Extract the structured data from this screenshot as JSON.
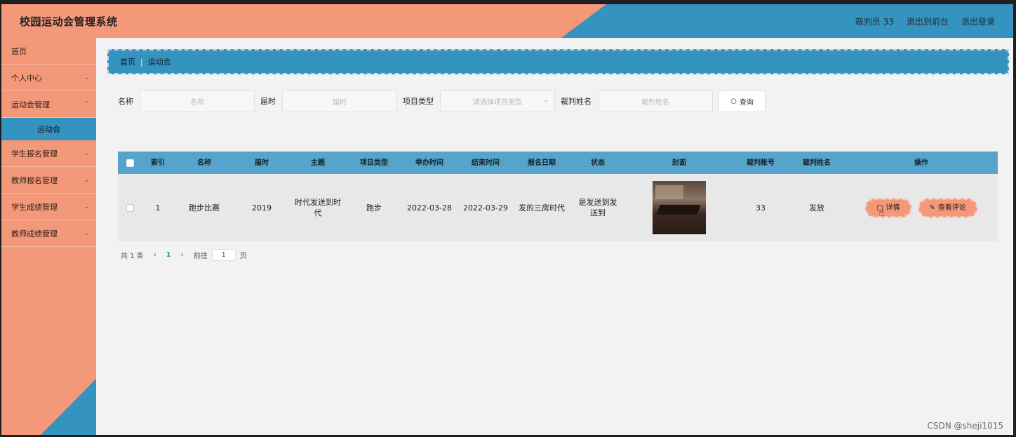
{
  "header": {
    "title": "校园运动会管理系统",
    "user": "裁判员 33",
    "front": "退出到前台",
    "logout": "退出登录"
  },
  "sidebar": {
    "items": [
      {
        "label": "首页",
        "chevron": false
      },
      {
        "label": "个人中心",
        "chevron": true
      },
      {
        "label": "运动会管理",
        "chevron": true
      },
      {
        "label": "学生报名管理",
        "chevron": true
      },
      {
        "label": "教师报名管理",
        "chevron": true
      },
      {
        "label": "学生成绩管理",
        "chevron": true
      },
      {
        "label": "教师成绩管理",
        "chevron": true
      }
    ],
    "active_sub": "运动会"
  },
  "breadcrumb": {
    "home": "首页",
    "current": "运动会"
  },
  "search": {
    "name_label": "名称",
    "name_placeholder": "名称",
    "session_label": "届时",
    "session_placeholder": "届时",
    "type_label": "项目类型",
    "type_placeholder": "请选择项目类型",
    "judge_label": "裁判姓名",
    "judge_placeholder": "裁判姓名",
    "query_label": "查询"
  },
  "table": {
    "headers": [
      "索引",
      "名称",
      "届时",
      "主题",
      "项目类型",
      "举办时间",
      "结束时间",
      "报名日期",
      "状态",
      "封面",
      "裁判账号",
      "裁判姓名",
      "操作"
    ],
    "rows": [
      {
        "index": "1",
        "name": "跑步比赛",
        "session": "2019",
        "theme": "时代发送到时代",
        "type": "跑步",
        "start": "2022-03-28",
        "end": "2022-03-29",
        "signup": "发的三房时代",
        "status": "是发送到发送到",
        "account": "33",
        "judge": "发放",
        "detail_label": "详情",
        "review_label": "查看评论"
      }
    ]
  },
  "pager": {
    "total": "共 1 条",
    "current": "1",
    "goto": "前往",
    "page_value": "1",
    "page_unit": "页"
  },
  "watermark": "CSDN @sheji1015",
  "colors": {
    "salmon": "#f4987a",
    "blue": "#3593c0",
    "header_blue": "#56a4cb",
    "page_active": "#2aa36f"
  }
}
